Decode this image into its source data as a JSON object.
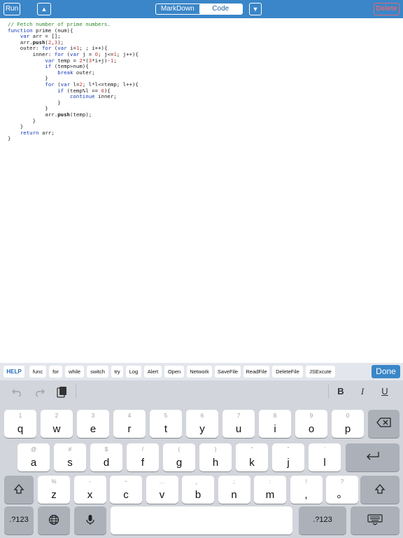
{
  "toolbar": {
    "run_label": "Run",
    "up_label": "▲",
    "segments": [
      "MarkDown",
      "Code"
    ],
    "active_segment": "Code",
    "down_label": "▼",
    "delete_label": "Delete",
    "colors": {
      "bar": "#3a86c8",
      "delete": "#e06a72"
    }
  },
  "code": {
    "lines": [
      "// Fetch number of prime numbers.",
      "function prime (num){",
      "    var arr = [];",
      "    arr.push(2,3);",
      "    outer: for (var i=1; ; i++){",
      "        inner: for (var j = 0; j<=1; j++){",
      "            var temp = 2*(3*i+j)-1;",
      "            if (temp>num){",
      "                break outer;",
      "            }",
      "            for (var l=2; l*l<=temp; l++){",
      "                if (temp%l == 0){",
      "                    continue inner;",
      "                }",
      "            }",
      "            arr.push(temp);",
      "        }",
      "    }",
      "    return arr;",
      "}"
    ]
  },
  "helper": {
    "buttons": [
      "HELP",
      "func",
      "for",
      "while",
      "switch",
      "try",
      "Log",
      "Alert",
      "Open",
      "Network",
      "SaveFile",
      "ReadFile",
      "DeleteFile",
      "JSExcute"
    ],
    "done_label": "Done"
  },
  "keyboard": {
    "assistant": {
      "undo_icon": "undo-icon",
      "redo_icon": "redo-icon",
      "paste_icon": "paste-icon",
      "bold": "B",
      "italic": "I",
      "underline": "U"
    },
    "row1": [
      {
        "sub": "1",
        "main": "q"
      },
      {
        "sub": "2",
        "main": "w"
      },
      {
        "sub": "3",
        "main": "e"
      },
      {
        "sub": "4",
        "main": "r"
      },
      {
        "sub": "5",
        "main": "t"
      },
      {
        "sub": "6",
        "main": "y"
      },
      {
        "sub": "7",
        "main": "u"
      },
      {
        "sub": "8",
        "main": "i"
      },
      {
        "sub": "9",
        "main": "o"
      },
      {
        "sub": "0",
        "main": "p"
      }
    ],
    "row2": [
      {
        "sub": "@",
        "main": "a"
      },
      {
        "sub": "#",
        "main": "s"
      },
      {
        "sub": "$",
        "main": "d"
      },
      {
        "sub": "/",
        "main": "f"
      },
      {
        "sub": "(",
        "main": "g"
      },
      {
        "sub": ")",
        "main": "h"
      },
      {
        "sub": "“",
        "main": "k"
      },
      {
        "sub": "”",
        "main": "j"
      },
      {
        "sub": "’",
        "main": "l"
      }
    ],
    "row3": [
      {
        "sub": "%",
        "main": "z"
      },
      {
        "sub": "-",
        "main": "x"
      },
      {
        "sub": "~",
        "main": "c"
      },
      {
        "sub": "…",
        "main": "v"
      },
      {
        "sub": "、",
        "main": "b"
      },
      {
        "sub": ";",
        "main": "n"
      },
      {
        "sub": ":",
        "main": "m"
      },
      {
        "sub": "!",
        "main": ","
      },
      {
        "sub": "?",
        "main": "。"
      }
    ],
    "numbers_label": ".?123",
    "numbers_label_right": ".?123"
  }
}
